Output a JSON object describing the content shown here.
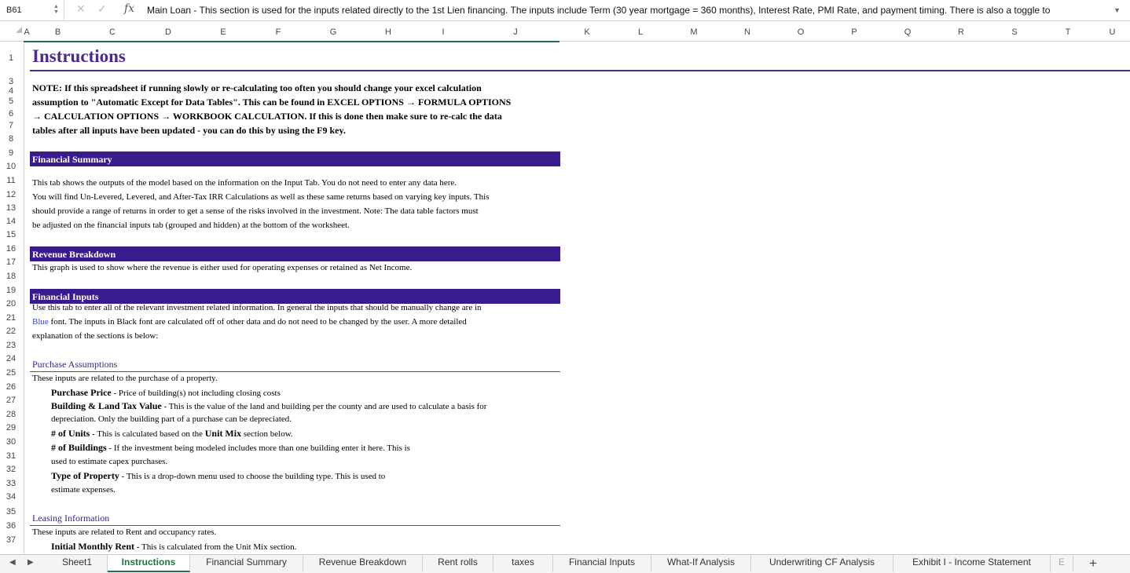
{
  "formula_bar": {
    "name_box": "B61",
    "fx": "fx",
    "formula": "Main Loan - This section is used for the inputs related directly to the 1st Lien financing.  The inputs include Term (30 year mortgage = 360 months), Interest Rate, PMI Rate, and payment timing.  There is also a toggle to"
  },
  "columns": [
    "A",
    "B",
    "C",
    "D",
    "E",
    "F",
    "G",
    "H",
    "I",
    "J",
    "K",
    "L",
    "M",
    "N",
    "O",
    "P",
    "Q",
    "R",
    "S",
    "T",
    "U"
  ],
  "rows": [
    "1",
    "3",
    "4",
    "5",
    "6",
    "7",
    "8",
    "9",
    "10",
    "11",
    "12",
    "13",
    "14",
    "15",
    "16",
    "17",
    "18",
    "19",
    "20",
    "21",
    "22",
    "23",
    "24",
    "25",
    "26",
    "27",
    "28",
    "29",
    "30",
    "31",
    "32",
    "33",
    "34",
    "35",
    "36",
    "37"
  ],
  "sheet": {
    "title": "Instructions",
    "note_lines": [
      "NOTE: If this spreadsheet if running slowly or re-calculating too often you should change your excel calculation",
      "assumption to \"Automatic Except for Data Tables\". This can be found in EXCEL OPTIONS → FORMULA OPTIONS",
      "→ CALCULATION OPTIONS → WORKBOOK CALCULATION.  If this is done then make sure to re-calc the data",
      "tables after all inputs have been updated - you can do this by using the F9 key."
    ],
    "financial_summary": {
      "header": "Financial Summary",
      "lines": [
        "This tab shows the outputs of the model based on the information on the Input Tab.  You do not need to enter any data here.",
        "You will find Un-Levered, Levered, and After-Tax IRR Calculations as well as these same returns based on varying key inputs.  This",
        "should provide a range of returns in order to get a sense of the  risks involved in the investment.  Note: The data table factors must",
        "be adjusted on the financial inputs tab (grouped and hidden) at the bottom of the worksheet."
      ]
    },
    "revenue_breakdown": {
      "header": "Revenue Breakdown",
      "line": "This graph is used to show where the revenue is either used for operating expenses or retained as Net Income."
    },
    "financial_inputs": {
      "header": "Financial Inputs",
      "line1": "Use this tab to enter all of the relevant investment related information. In general the inputs that should be manually change are in",
      "line2_blue": "Blue",
      "line2_rest": " font.  The inputs in Black font are calculated off of other data and do not need to be changed by the user.  A more detailed",
      "line3": "explanation of the sections is below:"
    },
    "purchase_assumptions": {
      "header": "Purchase Assumptions",
      "intro": "These inputs are related to the purchase of a property.",
      "purchase_price_term": "Purchase Price",
      "purchase_price_desc": " - Price of building(s) not including closing costs",
      "tax_value_term": "Building & Land Tax Value",
      "tax_value_desc": " - This is the value of the land and building per the county and are used to calculate a basis for",
      "tax_value_desc2": "depreciation.  Only the building part of a purchase can be depreciated.",
      "units_term": "# of Units",
      "units_desc_a": " - This is calculated based on the ",
      "units_desc_bold": "Unit Mix",
      "units_desc_b": " section below.",
      "buildings_term": "# of Buildings",
      "buildings_desc": " - If the investment being modeled includes more than one building enter it here. This is",
      "buildings_desc2": "used to estimate capex purchases.",
      "type_term": "Type of Property",
      "type_desc": " - This is a drop-down menu used to choose the building type.  This is used to",
      "type_desc2": "estimate expenses."
    },
    "leasing_information": {
      "header": "Leasing Information",
      "intro": "These inputs are related to Rent and occupancy rates.",
      "rent_term": "Initial Monthly Rent",
      "rent_desc": " - This is calculated from the Unit Mix section."
    }
  },
  "tabs": [
    "Sheet1",
    "Instructions",
    "Financial Summary",
    "Revenue Breakdown",
    "Rent rolls",
    "taxes",
    "Financial Inputs",
    "What-If Analysis",
    "Underwriting CF Analysis",
    "Exhibit I - Income Statement",
    "E"
  ],
  "active_tab": "Instructions",
  "colors": {
    "accent": "#3a1b8e",
    "excel_green": "#1f7246"
  }
}
